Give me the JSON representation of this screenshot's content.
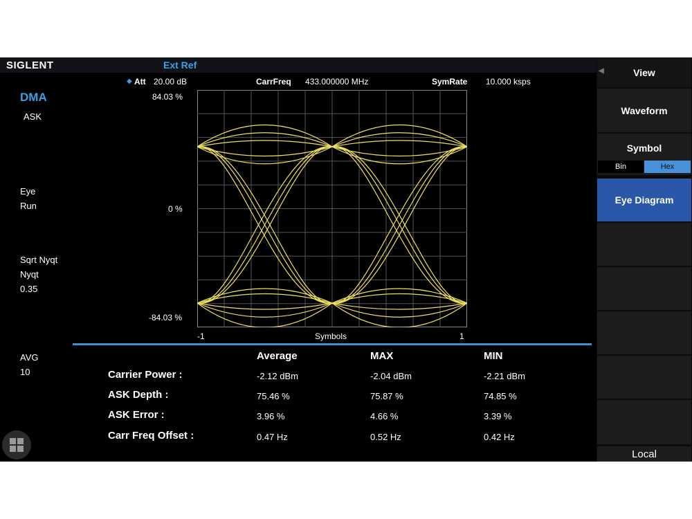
{
  "brand": "SIGLENT",
  "ext_ref": "Ext Ref",
  "header": {
    "att_label": "Att",
    "att_value": "20.00 dB",
    "carrfreq_label": "CarrFreq",
    "carrfreq_value": "433.000000 MHz",
    "symrate_label": "SymRate",
    "symrate_value": "10.000 ksps"
  },
  "left_panel": {
    "mode": "DMA",
    "modulation": "ASK",
    "eye": "Eye",
    "run": "Run",
    "filter": "Sqrt Nyqt",
    "filter2": "Nyqt",
    "alpha": "0.35",
    "avg_label": "AVG",
    "avg_value": "10"
  },
  "plot": {
    "y_top": "84.03 %",
    "y_mid": "0 %",
    "y_bottom": "-84.03 %",
    "x_left": "-1",
    "x_label": "Symbols",
    "x_right": "1",
    "trace_color": "#f0e060",
    "grid_color": "#555555"
  },
  "table": {
    "headers": [
      "Average",
      "MAX",
      "MIN"
    ],
    "rows": [
      {
        "label": "Carrier Power :",
        "values": [
          "-2.12 dBm",
          "-2.04 dBm",
          "-2.21 dBm"
        ]
      },
      {
        "label": "ASK Depth :",
        "values": [
          "75.46 %",
          "75.87 %",
          "74.85 %"
        ]
      },
      {
        "label": "ASK Error :",
        "values": [
          "3.96 %",
          "4.66 %",
          "3.39 %"
        ]
      },
      {
        "label": "Carr Freq Offset :",
        "values": [
          "0.47 Hz",
          "0.52 Hz",
          "0.42 Hz"
        ]
      }
    ]
  },
  "right_panel": {
    "view": "View",
    "waveform": "Waveform",
    "symbol": "Symbol",
    "bin": "Bin",
    "hex": "Hex",
    "eye_diagram": "Eye Diagram",
    "local": "Local",
    "accent": "#2a57a8",
    "hex_color": "#4a90d9"
  }
}
